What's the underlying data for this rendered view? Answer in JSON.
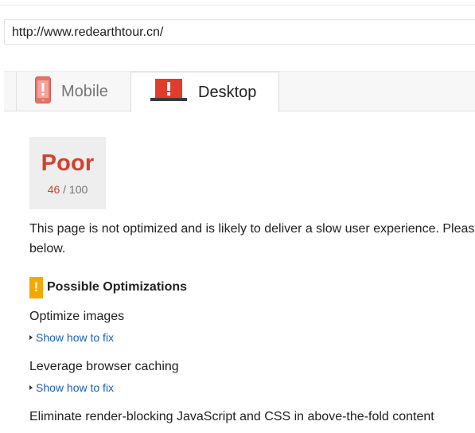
{
  "url_input": {
    "value": "http://www.redearthtour.cn/"
  },
  "tabs": [
    {
      "label": "Mobile",
      "icon": "mobile-phone-warning-icon",
      "selected": false
    },
    {
      "label": "Desktop",
      "icon": "desktop-monitor-warning-icon",
      "selected": true
    }
  ],
  "score": {
    "grade": "Poor",
    "value": "46",
    "max": "/ 100",
    "color": "#d0422e"
  },
  "summary": {
    "line1": "This page is not optimized and is likely to deliver a slow user experience. Please",
    "line2": "below."
  },
  "optimizations": {
    "heading": "Possible Optimizations",
    "badge": "!",
    "badge_color": "#f5a800",
    "items": [
      {
        "title": "Optimize images",
        "link": "Show how to fix"
      },
      {
        "title": "Leverage browser caching",
        "link": "Show how to fix"
      },
      {
        "title": "Eliminate render-blocking JavaScript and CSS in above-the-fold content"
      }
    ]
  },
  "colors": {
    "link": "#1a5fbf",
    "warning_red": "#e25541"
  }
}
